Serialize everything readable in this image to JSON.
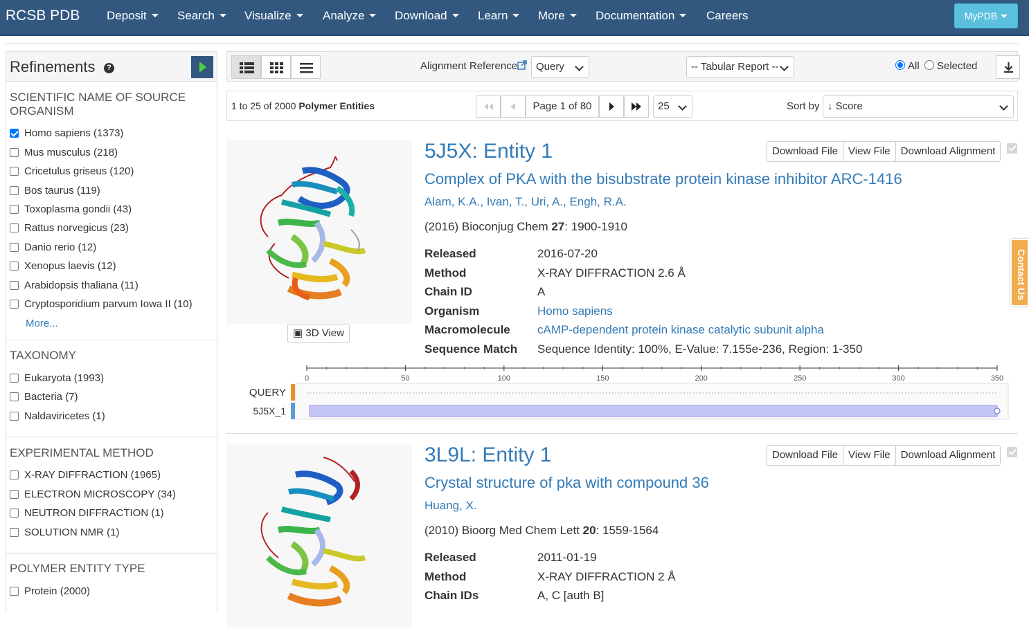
{
  "nav": {
    "brand": "RCSB PDB",
    "items": [
      "Deposit",
      "Search",
      "Visualize",
      "Analyze",
      "Download",
      "Learn",
      "More",
      "Documentation",
      "Careers"
    ],
    "mypdb": "MyPDB"
  },
  "sidebar": {
    "title": "Refinements",
    "help": "?",
    "sections": [
      {
        "title": "SCIENTIFIC NAME OF SOURCE ORGANISM",
        "items": [
          {
            "label": "Homo sapiens (1373)",
            "checked": true
          },
          {
            "label": "Mus musculus (218)",
            "checked": false
          },
          {
            "label": "Cricetulus griseus (120)",
            "checked": false
          },
          {
            "label": "Bos taurus (119)",
            "checked": false
          },
          {
            "label": "Toxoplasma gondii (43)",
            "checked": false
          },
          {
            "label": "Rattus norvegicus (23)",
            "checked": false
          },
          {
            "label": "Danio rerio (12)",
            "checked": false
          },
          {
            "label": "Xenopus laevis (12)",
            "checked": false
          },
          {
            "label": "Arabidopsis thaliana (11)",
            "checked": false
          },
          {
            "label": "Cryptosporidium parvum Iowa II (10)",
            "checked": false
          }
        ],
        "more": "More..."
      },
      {
        "title": "TAXONOMY",
        "items": [
          {
            "label": "Eukaryota (1993)",
            "checked": false
          },
          {
            "label": "Bacteria (7)",
            "checked": false
          },
          {
            "label": "Naldaviricetes (1)",
            "checked": false
          }
        ]
      },
      {
        "title": "EXPERIMENTAL METHOD",
        "items": [
          {
            "label": "X-RAY DIFFRACTION (1965)",
            "checked": false
          },
          {
            "label": "ELECTRON MICROSCOPY (34)",
            "checked": false
          },
          {
            "label": "NEUTRON DIFFRACTION (1)",
            "checked": false
          },
          {
            "label": "SOLUTION NMR (1)",
            "checked": false
          }
        ]
      },
      {
        "title": "POLYMER ENTITY TYPE",
        "items": [
          {
            "label": "Protein (2000)",
            "checked": false
          }
        ]
      }
    ]
  },
  "toolbar": {
    "alignment_label": "Alignment Reference",
    "alignment_value": "Query",
    "report_value": "-- Tabular Report --",
    "all_label": "All",
    "selected_label": "Selected",
    "scope_selected": "All"
  },
  "pager": {
    "summary_prefix": "1 to 25 of 2000",
    "summary_bold": "Polymer Entities",
    "page_label": "Page 1 of 80",
    "per_page": "25",
    "sort_label": "Sort by",
    "sort_value": "↓ Score"
  },
  "results": [
    {
      "title": "5J5X: Entity 1",
      "subtitle": "Complex of PKA with the bisubstrate protein kinase inhibitor ARC-1416",
      "authors": [
        "Alam, K.A.",
        "Ivan, T.",
        "Uri, A.",
        "Engh, R.A."
      ],
      "citation_pre": "(2016) Bioconjug Chem ",
      "citation_vol": "27",
      "citation_post": ": 1900-1910",
      "btn_download_file": "Download File",
      "btn_view_file": "View File",
      "btn_download_alignment": "Download Alignment",
      "view3d": "3D View",
      "fields": [
        {
          "k": "Released",
          "v": "2016-07-20",
          "link": false
        },
        {
          "k": "Method",
          "v": "X-RAY DIFFRACTION 2.6 Å",
          "link": false
        },
        {
          "k": "Chain ID",
          "v": "A",
          "link": false
        },
        {
          "k": "Organism",
          "v": "Homo sapiens",
          "link": true
        },
        {
          "k": "Macromolecule",
          "v": "cAMP-dependent protein kinase catalytic subunit alpha",
          "link": true
        },
        {
          "k": "Sequence Match",
          "v": "Sequence Identity: 100%, E-Value: 7.155e-236, Region: 1-350",
          "link": false
        }
      ],
      "alignment": {
        "ticks": [
          "0",
          "50",
          "100",
          "150",
          "200",
          "250",
          "300",
          "350"
        ],
        "range_max": 350,
        "query_label": "QUERY",
        "hit_label": "5J5X_1",
        "hit_start": 1,
        "hit_end": 350,
        "query_color": "#e8922a",
        "hit_color": "#5b9bd5",
        "bar_color": "#c4c4f5"
      }
    },
    {
      "title": "3L9L: Entity 1",
      "subtitle": "Crystal structure of pka with compound 36",
      "authors": [
        "Huang, X."
      ],
      "citation_pre": "(2010) Bioorg Med Chem Lett ",
      "citation_vol": "20",
      "citation_post": ": 1559-1564",
      "btn_download_file": "Download File",
      "btn_view_file": "View File",
      "btn_download_alignment": "Download Alignment",
      "fields": [
        {
          "k": "Released",
          "v": "2011-01-19",
          "link": false
        },
        {
          "k": "Method",
          "v": "X-RAY DIFFRACTION 2 Å",
          "link": false
        },
        {
          "k": "Chain IDs",
          "v": "A, C [auth B]",
          "link": false
        }
      ]
    }
  ],
  "contact": "Contact Us",
  "colors": {
    "nav": "#325880",
    "link": "#337ab7",
    "mypdb": "#5bc0de",
    "contact": "#f0ad4e"
  }
}
